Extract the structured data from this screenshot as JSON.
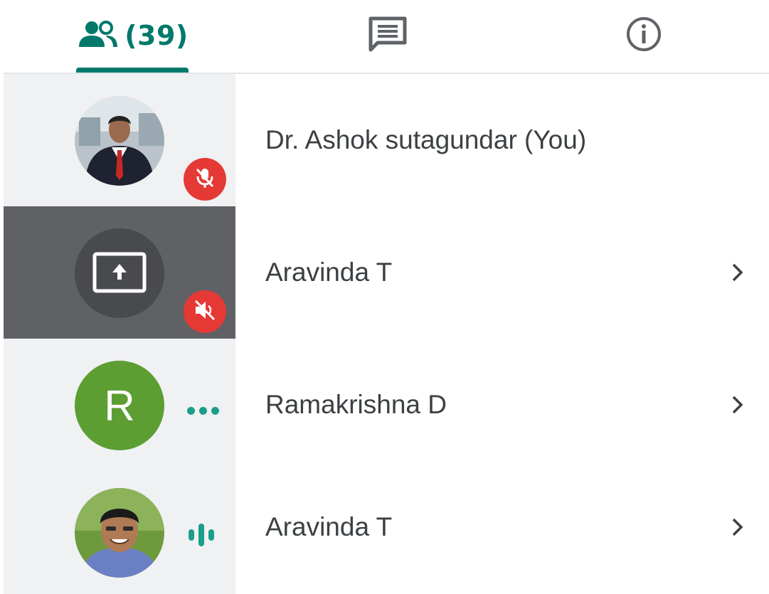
{
  "tabs": {
    "people": {
      "icon": "people-icon",
      "count_label": "(39)",
      "selected": true
    },
    "chat": {
      "icon": "chat-icon"
    },
    "info": {
      "icon": "info-icon"
    }
  },
  "colors": {
    "accent": "#00796b",
    "muted_badge": "#e53935",
    "avatar_r": "#5c9e31",
    "presenting_bg": "#5f6164",
    "activity": "#1a9e8a"
  },
  "participants": [
    {
      "name": "Dr. Ashok sutagundar (You)",
      "avatar": "photo",
      "status": "mic-off-icon",
      "has_chevron": false
    },
    {
      "name": "Aravinda T",
      "avatar": "present-screen-icon",
      "status": "volume-off-icon",
      "presenting": true,
      "has_chevron": true
    },
    {
      "name": "Ramakrishna D",
      "avatar_letter": "R",
      "status": "more-dots-icon",
      "has_chevron": true
    },
    {
      "name": "Aravinda T",
      "avatar": "photo",
      "status": "audio-level-icon",
      "has_chevron": true
    }
  ]
}
